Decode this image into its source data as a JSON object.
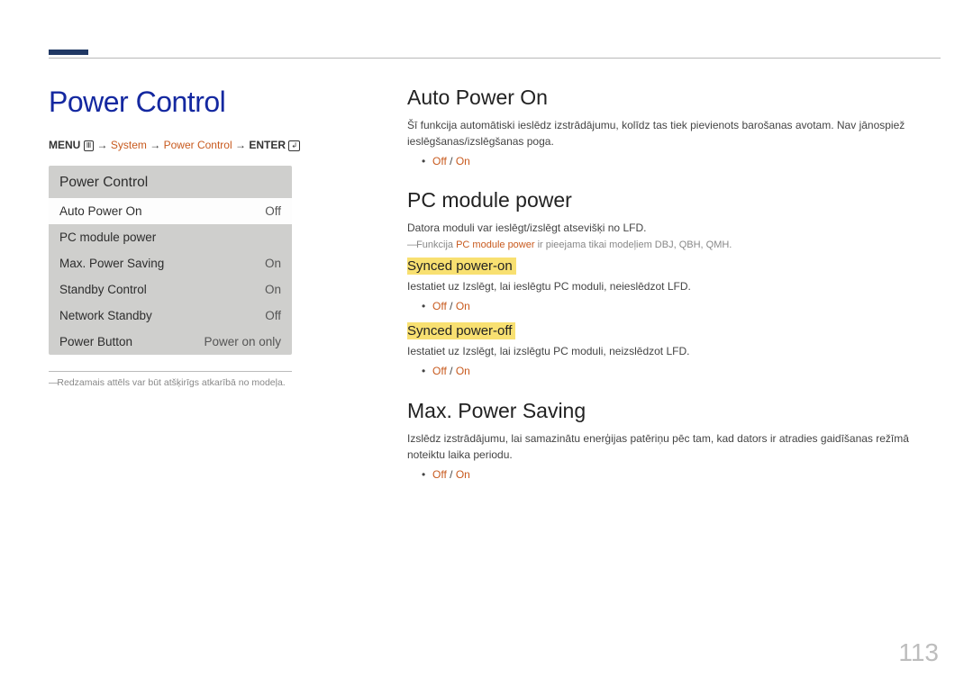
{
  "pageNumber": "113",
  "title": "Power Control",
  "menuPath": {
    "menu": "MENU",
    "arrow": "→",
    "system": "System",
    "powerControl": "Power Control",
    "enter": "ENTER"
  },
  "osd": {
    "title": "Power Control",
    "rows": [
      {
        "label": "Auto Power On",
        "value": "Off",
        "sel": true
      },
      {
        "label": "PC module power",
        "value": "",
        "sel": false
      },
      {
        "label": "Max. Power Saving",
        "value": "On",
        "sel": false
      },
      {
        "label": "Standby Control",
        "value": "On",
        "sel": false
      },
      {
        "label": "Network Standby",
        "value": "Off",
        "sel": false
      },
      {
        "label": "Power Button",
        "value": "Power on only",
        "sel": false
      }
    ]
  },
  "footnote": "Redzamais attēls var būt atšķirīgs atkarībā no modeļa.",
  "sections": {
    "autoPowerOn": {
      "heading": "Auto Power On",
      "text": "Šī funkcija automātiski ieslēdz izstrādājumu, kolīdz tas tiek pievienots barošanas avotam. Nav jānospiež ieslēgšanas/izslēgšanas poga.",
      "opts": {
        "off": "Off",
        "sep": " / ",
        "on": "On"
      }
    },
    "pcModulePower": {
      "heading": "PC module power",
      "text": "Datora moduli var ieslēgt/izslēgt atsevišķi no LFD.",
      "note": {
        "pre": "Funkcija ",
        "em": "PC module power",
        "post": " ir pieejama tikai modeļiem DBJ, QBH, QMH."
      },
      "syncOn": {
        "heading": "Synced power-on",
        "text": "Iestatiet uz Izslēgt, lai ieslēgtu PC moduli, neieslēdzot LFD.",
        "opts": {
          "off": "Off",
          "sep": " / ",
          "on": "On"
        }
      },
      "syncOff": {
        "heading": "Synced power-off",
        "text": "Iestatiet uz Izslēgt, lai izslēgtu PC moduli, neizslēdzot LFD.",
        "opts": {
          "off": "Off",
          "sep": " / ",
          "on": "On"
        }
      }
    },
    "maxPowerSaving": {
      "heading": "Max. Power Saving",
      "text": "Izslēdz izstrādājumu, lai samazinātu enerģijas patēriņu pēc tam, kad dators ir atradies gaidīšanas režīmā noteiktu laika periodu.",
      "opts": {
        "off": "Off",
        "sep": " / ",
        "on": "On"
      }
    }
  }
}
